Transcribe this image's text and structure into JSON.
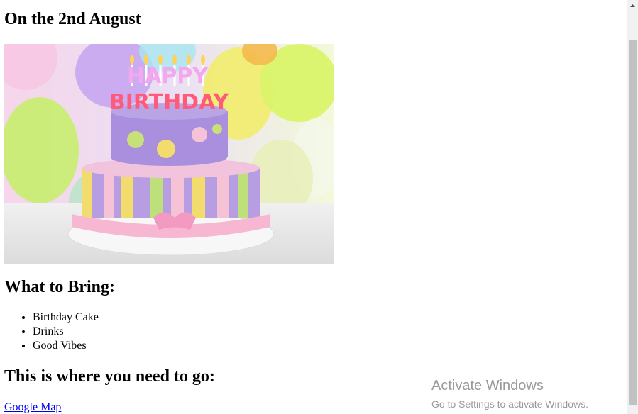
{
  "page": {
    "heading_date": "On the 2nd August",
    "heading_bring": "What to Bring:",
    "items": [
      "Birthday Cake",
      "Drinks",
      "Good Vibes"
    ],
    "heading_go": "This is where you need to go:",
    "link_text": "Google Map"
  },
  "image": {
    "alt": "HAPPY BIRTHDAY",
    "topper_line1": "HAPPY",
    "topper_line2": "BIRTHDAY"
  },
  "overlay": {
    "line1": "Activate Windows",
    "line2": "Go to Settings to activate Windows."
  }
}
